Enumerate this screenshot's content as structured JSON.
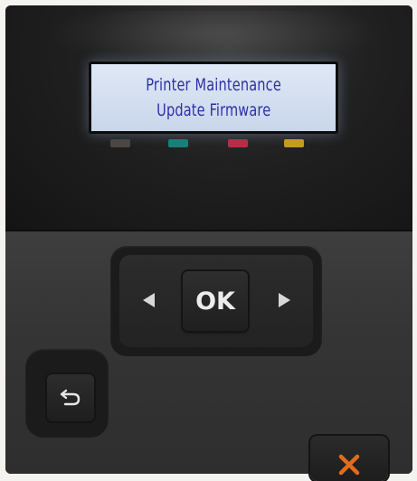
{
  "display": {
    "line1": "Printer Maintenance",
    "line2": "Update Firmware",
    "text_color": "#2c2fa8",
    "background_color": "#d4deef"
  },
  "ink_indicators": [
    {
      "name": "black",
      "color": "#4a4644"
    },
    {
      "name": "cyan",
      "color": "#197f79"
    },
    {
      "name": "magenta",
      "color": "#b72d46"
    },
    {
      "name": "yellow",
      "color": "#c29b1f"
    }
  ],
  "controls": {
    "ok_label": "OK",
    "left_icon": "left-arrow-icon",
    "right_icon": "right-arrow-icon",
    "back_icon": "back-arrow-icon",
    "cancel_icon": "cancel-x-icon",
    "cancel_icon_color": "#e26b1c"
  }
}
